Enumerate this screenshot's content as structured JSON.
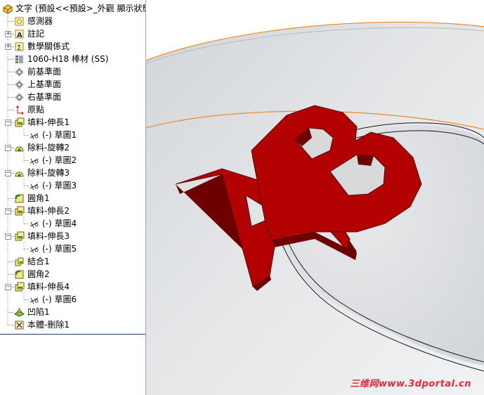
{
  "tree": {
    "root": {
      "label": "文字 (預設<<預設>_外觀 顯示狀態",
      "icon": "part-icon"
    },
    "nodes": [
      {
        "id": "sensors",
        "label": "感測器",
        "icon": "sensor-icon",
        "expander": false
      },
      {
        "id": "annotations",
        "label": "註記",
        "icon": "annotation-icon",
        "expander": true
      },
      {
        "id": "equations",
        "label": "數學關係式",
        "icon": "equation-icon",
        "expander": true
      },
      {
        "id": "material",
        "label": "1060-H18 棒材 (SS)",
        "icon": "material-icon",
        "expander": false
      },
      {
        "id": "front-plane",
        "label": "前基準面",
        "icon": "plane-icon",
        "expander": false
      },
      {
        "id": "top-plane",
        "label": "上基準面",
        "icon": "plane-icon",
        "expander": false
      },
      {
        "id": "right-plane",
        "label": "右基準面",
        "icon": "plane-icon",
        "expander": false
      },
      {
        "id": "origin",
        "label": "原點",
        "icon": "origin-icon",
        "expander": false
      },
      {
        "id": "boss-extrude1",
        "label": "填料-伸長1",
        "icon": "boss-extrude-icon",
        "expander": true
      },
      {
        "id": "sketch1",
        "label": "(-) 草圖1",
        "icon": "sketch-icon",
        "child": true
      },
      {
        "id": "cut-revolve2",
        "label": "除料-旋轉2",
        "icon": "cut-revolve-icon",
        "expander": true
      },
      {
        "id": "sketch2",
        "label": "(-) 草圖2",
        "icon": "sketch-icon",
        "child": true
      },
      {
        "id": "cut-revolve3",
        "label": "除料-旋轉3",
        "icon": "cut-revolve-icon",
        "expander": true
      },
      {
        "id": "sketch3",
        "label": "(-) 草圖3",
        "icon": "sketch-icon",
        "child": true
      },
      {
        "id": "fillet1",
        "label": "圓角1",
        "icon": "fillet-icon",
        "expander": false
      },
      {
        "id": "boss-extrude2",
        "label": "填料-伸長2",
        "icon": "boss-extrude-icon",
        "expander": true
      },
      {
        "id": "sketch4",
        "label": "(-) 草圖4",
        "icon": "sketch-icon",
        "child": true
      },
      {
        "id": "boss-extrude3",
        "label": "填料-伸長3",
        "icon": "boss-extrude-icon",
        "expander": true
      },
      {
        "id": "sketch5",
        "label": "(-) 草圖5",
        "icon": "sketch-icon",
        "child": true
      },
      {
        "id": "combine1",
        "label": "結合1",
        "icon": "combine-icon",
        "expander": false
      },
      {
        "id": "fillet2",
        "label": "圓角2",
        "icon": "fillet-icon",
        "expander": false
      },
      {
        "id": "boss-extrude4",
        "label": "填料-伸長4",
        "icon": "boss-extrude-icon",
        "expander": true
      },
      {
        "id": "sketch6",
        "label": "(-) 草圖6",
        "icon": "sketch-icon",
        "child": true
      },
      {
        "id": "indent1",
        "label": "凹陷1",
        "icon": "indent-icon",
        "expander": false
      },
      {
        "id": "delete-body1",
        "label": "本體-刪除1",
        "icon": "delete-body-icon",
        "expander": false
      }
    ]
  },
  "viewport": {
    "letters": [
      "A",
      "B"
    ],
    "letter_color": "#b30000",
    "letter_side_color": "#6e0000",
    "disc_color": "#e6e8ea",
    "edge_highlight_color": "#f08a1c"
  },
  "watermark": "三维网www.3dportal.cn"
}
